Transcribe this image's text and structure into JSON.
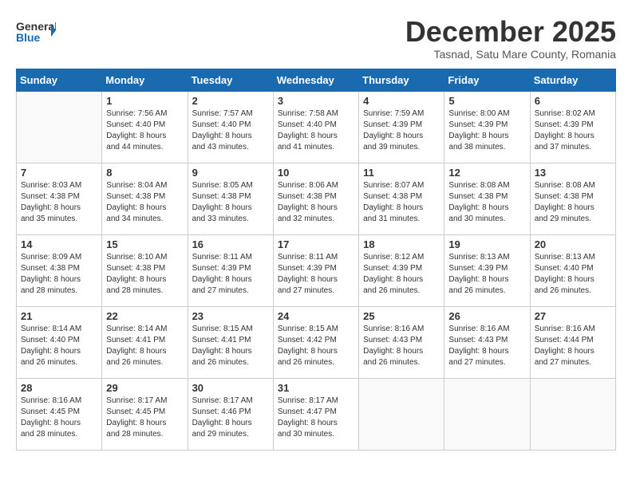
{
  "header": {
    "logo_general": "General",
    "logo_blue": "Blue",
    "month_title": "December 2025",
    "subtitle": "Tasnad, Satu Mare County, Romania"
  },
  "days_of_week": [
    "Sunday",
    "Monday",
    "Tuesday",
    "Wednesday",
    "Thursday",
    "Friday",
    "Saturday"
  ],
  "weeks": [
    [
      {
        "day": "",
        "info": ""
      },
      {
        "day": "1",
        "info": "Sunrise: 7:56 AM\nSunset: 4:40 PM\nDaylight: 8 hours\nand 44 minutes."
      },
      {
        "day": "2",
        "info": "Sunrise: 7:57 AM\nSunset: 4:40 PM\nDaylight: 8 hours\nand 43 minutes."
      },
      {
        "day": "3",
        "info": "Sunrise: 7:58 AM\nSunset: 4:40 PM\nDaylight: 8 hours\nand 41 minutes."
      },
      {
        "day": "4",
        "info": "Sunrise: 7:59 AM\nSunset: 4:39 PM\nDaylight: 8 hours\nand 39 minutes."
      },
      {
        "day": "5",
        "info": "Sunrise: 8:00 AM\nSunset: 4:39 PM\nDaylight: 8 hours\nand 38 minutes."
      },
      {
        "day": "6",
        "info": "Sunrise: 8:02 AM\nSunset: 4:39 PM\nDaylight: 8 hours\nand 37 minutes."
      }
    ],
    [
      {
        "day": "7",
        "info": "Sunrise: 8:03 AM\nSunset: 4:38 PM\nDaylight: 8 hours\nand 35 minutes."
      },
      {
        "day": "8",
        "info": "Sunrise: 8:04 AM\nSunset: 4:38 PM\nDaylight: 8 hours\nand 34 minutes."
      },
      {
        "day": "9",
        "info": "Sunrise: 8:05 AM\nSunset: 4:38 PM\nDaylight: 8 hours\nand 33 minutes."
      },
      {
        "day": "10",
        "info": "Sunrise: 8:06 AM\nSunset: 4:38 PM\nDaylight: 8 hours\nand 32 minutes."
      },
      {
        "day": "11",
        "info": "Sunrise: 8:07 AM\nSunset: 4:38 PM\nDaylight: 8 hours\nand 31 minutes."
      },
      {
        "day": "12",
        "info": "Sunrise: 8:08 AM\nSunset: 4:38 PM\nDaylight: 8 hours\nand 30 minutes."
      },
      {
        "day": "13",
        "info": "Sunrise: 8:08 AM\nSunset: 4:38 PM\nDaylight: 8 hours\nand 29 minutes."
      }
    ],
    [
      {
        "day": "14",
        "info": "Sunrise: 8:09 AM\nSunset: 4:38 PM\nDaylight: 8 hours\nand 28 minutes."
      },
      {
        "day": "15",
        "info": "Sunrise: 8:10 AM\nSunset: 4:38 PM\nDaylight: 8 hours\nand 28 minutes."
      },
      {
        "day": "16",
        "info": "Sunrise: 8:11 AM\nSunset: 4:39 PM\nDaylight: 8 hours\nand 27 minutes."
      },
      {
        "day": "17",
        "info": "Sunrise: 8:11 AM\nSunset: 4:39 PM\nDaylight: 8 hours\nand 27 minutes."
      },
      {
        "day": "18",
        "info": "Sunrise: 8:12 AM\nSunset: 4:39 PM\nDaylight: 8 hours\nand 26 minutes."
      },
      {
        "day": "19",
        "info": "Sunrise: 8:13 AM\nSunset: 4:39 PM\nDaylight: 8 hours\nand 26 minutes."
      },
      {
        "day": "20",
        "info": "Sunrise: 8:13 AM\nSunset: 4:40 PM\nDaylight: 8 hours\nand 26 minutes."
      }
    ],
    [
      {
        "day": "21",
        "info": "Sunrise: 8:14 AM\nSunset: 4:40 PM\nDaylight: 8 hours\nand 26 minutes."
      },
      {
        "day": "22",
        "info": "Sunrise: 8:14 AM\nSunset: 4:41 PM\nDaylight: 8 hours\nand 26 minutes."
      },
      {
        "day": "23",
        "info": "Sunrise: 8:15 AM\nSunset: 4:41 PM\nDaylight: 8 hours\nand 26 minutes."
      },
      {
        "day": "24",
        "info": "Sunrise: 8:15 AM\nSunset: 4:42 PM\nDaylight: 8 hours\nand 26 minutes."
      },
      {
        "day": "25",
        "info": "Sunrise: 8:16 AM\nSunset: 4:43 PM\nDaylight: 8 hours\nand 26 minutes."
      },
      {
        "day": "26",
        "info": "Sunrise: 8:16 AM\nSunset: 4:43 PM\nDaylight: 8 hours\nand 27 minutes."
      },
      {
        "day": "27",
        "info": "Sunrise: 8:16 AM\nSunset: 4:44 PM\nDaylight: 8 hours\nand 27 minutes."
      }
    ],
    [
      {
        "day": "28",
        "info": "Sunrise: 8:16 AM\nSunset: 4:45 PM\nDaylight: 8 hours\nand 28 minutes."
      },
      {
        "day": "29",
        "info": "Sunrise: 8:17 AM\nSunset: 4:45 PM\nDaylight: 8 hours\nand 28 minutes."
      },
      {
        "day": "30",
        "info": "Sunrise: 8:17 AM\nSunset: 4:46 PM\nDaylight: 8 hours\nand 29 minutes."
      },
      {
        "day": "31",
        "info": "Sunrise: 8:17 AM\nSunset: 4:47 PM\nDaylight: 8 hours\nand 30 minutes."
      },
      {
        "day": "",
        "info": ""
      },
      {
        "day": "",
        "info": ""
      },
      {
        "day": "",
        "info": ""
      }
    ]
  ]
}
